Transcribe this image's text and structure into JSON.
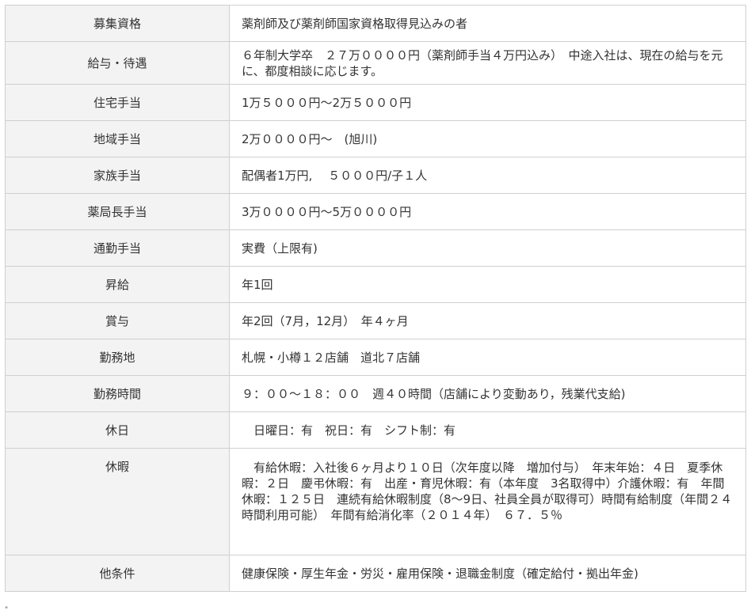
{
  "rows": [
    {
      "label": "募集資格",
      "value": "薬剤師及び薬剤師国家資格取得見込みの者"
    },
    {
      "label": "給与・待遇",
      "value": "６年制大学卒　２７万００００円（薬剤師手当４万円込み）　中途入社は、現在の給与を元に、都度相談に応じます。"
    },
    {
      "label": "住宅手当",
      "value": "1万５０００円～2万５０００円"
    },
    {
      "label": "地域手当",
      "value": "2万００００円～　(旭川)"
    },
    {
      "label": "家族手当",
      "value": "配偶者1万円,　 ５０００円/子１人"
    },
    {
      "label": "薬局長手当",
      "value": "3万００００円～5万００００円"
    },
    {
      "label": "通勤手当",
      "value": "実費（上限有)"
    },
    {
      "label": "昇給",
      "value": "年1回"
    },
    {
      "label": "賞与",
      "value": "年2回（7月，12月）　年４ヶ月"
    },
    {
      "label": "勤務地",
      "value": "札幌・小樽１２店舗　道北７店舗"
    },
    {
      "label": "勤務時間",
      "value": "９：００～１８：００　週４０時間（店舗により変動あり，残業代支給)"
    },
    {
      "label": "休日",
      "value": "　日曜日：有　祝日：有　シフト制：有"
    },
    {
      "label": "休暇",
      "value": "　有給休暇：入社後６ヶ月より１０日（次年度以降　増加付与）　年末年始：４日　夏季休暇：２日　慶弔休暇：有　出産・育児休暇：有（本年度　3名取得中）介護休暇：有　年間休暇：１２５日　連続有給休暇制度（8～9日、社員全員が取得可）時間有給制度（年間２４時間利用可能）　年間有給消化率（２０１４年）　６７．５％"
    },
    {
      "label": "他条件",
      "value": "健康保険・厚生年金・労災・雇用保険・退職金制度（確定給付・拠出年金)"
    }
  ],
  "footnote_mark": "\""
}
